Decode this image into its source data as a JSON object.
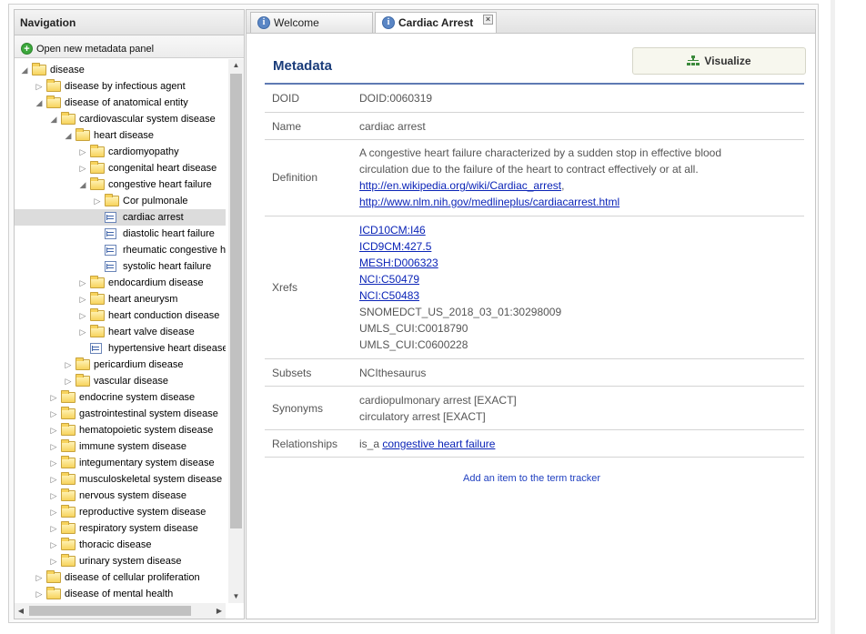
{
  "nav": {
    "title": "Navigation",
    "open_panel": "Open new metadata panel",
    "tree": [
      {
        "label": "disease",
        "icon": "folder",
        "toggle": "open"
      },
      {
        "label": "disease by infectious agent",
        "icon": "folder",
        "toggle": "closed"
      },
      {
        "label": "disease of anatomical entity",
        "icon": "folder",
        "toggle": "open"
      },
      {
        "label": "cardiovascular system disease",
        "icon": "folder",
        "toggle": "open"
      },
      {
        "label": "heart disease",
        "icon": "folder",
        "toggle": "open"
      },
      {
        "label": "cardiomyopathy",
        "icon": "folder",
        "toggle": "closed"
      },
      {
        "label": "congenital heart disease",
        "icon": "folder",
        "toggle": "closed"
      },
      {
        "label": "congestive heart failure",
        "icon": "folder",
        "toggle": "open"
      },
      {
        "label": "Cor pulmonale",
        "icon": "folder",
        "toggle": "closed"
      },
      {
        "label": "cardiac arrest",
        "icon": "leaf",
        "toggle": "none",
        "selected": true
      },
      {
        "label": "diastolic heart failure",
        "icon": "leaf",
        "toggle": "none"
      },
      {
        "label": "rheumatic congestive he",
        "icon": "leaf",
        "toggle": "none"
      },
      {
        "label": "systolic heart failure",
        "icon": "leaf",
        "toggle": "none"
      },
      {
        "label": "endocardium disease",
        "icon": "folder",
        "toggle": "closed"
      },
      {
        "label": "heart aneurysm",
        "icon": "folder",
        "toggle": "closed"
      },
      {
        "label": "heart conduction disease",
        "icon": "folder",
        "toggle": "closed"
      },
      {
        "label": "heart valve disease",
        "icon": "folder",
        "toggle": "closed"
      },
      {
        "label": "hypertensive heart disease",
        "icon": "leaf",
        "toggle": "none"
      },
      {
        "label": "pericardium disease",
        "icon": "folder",
        "toggle": "closed"
      },
      {
        "label": "vascular disease",
        "icon": "folder",
        "toggle": "closed"
      },
      {
        "label": "endocrine system disease",
        "icon": "folder",
        "toggle": "closed"
      },
      {
        "label": "gastrointestinal system disease",
        "icon": "folder",
        "toggle": "closed"
      },
      {
        "label": "hematopoietic system disease",
        "icon": "folder",
        "toggle": "closed"
      },
      {
        "label": "immune system disease",
        "icon": "folder",
        "toggle": "closed"
      },
      {
        "label": "integumentary system disease",
        "icon": "folder",
        "toggle": "closed"
      },
      {
        "label": "musculoskeletal system disease",
        "icon": "folder",
        "toggle": "closed"
      },
      {
        "label": "nervous system disease",
        "icon": "folder",
        "toggle": "closed"
      },
      {
        "label": "reproductive system disease",
        "icon": "folder",
        "toggle": "closed"
      },
      {
        "label": "respiratory system disease",
        "icon": "folder",
        "toggle": "closed"
      },
      {
        "label": "thoracic disease",
        "icon": "folder",
        "toggle": "closed"
      },
      {
        "label": "urinary system disease",
        "icon": "folder",
        "toggle": "closed"
      },
      {
        "label": "disease of cellular proliferation",
        "icon": "folder",
        "toggle": "closed"
      },
      {
        "label": "disease of mental health",
        "icon": "folder",
        "toggle": "closed"
      }
    ]
  },
  "tabs": {
    "welcome": "Welcome",
    "active": "Cardiac Arrest",
    "close": "×"
  },
  "metadata": {
    "title": "Metadata",
    "visualize": "Visualize",
    "doid_key": "DOID",
    "doid_value": "DOID:0060319",
    "name_key": "Name",
    "name_value": "cardiac arrest",
    "definition_key": "Definition",
    "definition_text_1": "A congestive heart failure characterized by a sudden stop in effective blood",
    "definition_text_2": "circulation due to the failure of the heart to contract effectively or at all.",
    "definition_link_1": "http://en.wikipedia.org/wiki/Cardiac_arrest",
    "definition_sep": ",",
    "definition_link_2": "http://www.nlm.nih.gov/medlineplus/cardiacarrest.html",
    "xrefs_key": "Xrefs",
    "xref_links": [
      "ICD10CM:I46",
      "ICD9CM:427.5",
      "MESH:D006323",
      "NCI:C50479",
      "NCI:C50483"
    ],
    "xref_texts": [
      "SNOMEDCT_US_2018_03_01:30298009",
      "UMLS_CUI:C0018790",
      "UMLS_CUI:C0600228"
    ],
    "subsets_key": "Subsets",
    "subsets_value": "NCIthesaurus",
    "synonyms_key": "Synonyms",
    "synonym_1": "cardiopulmonary arrest [EXACT]",
    "synonym_2": "circulatory arrest [EXACT]",
    "relationships_key": "Relationships",
    "relationship_prefix": "is_a",
    "relationship_link": "congestive heart failure",
    "tracker": "Add an item to the term tracker"
  }
}
